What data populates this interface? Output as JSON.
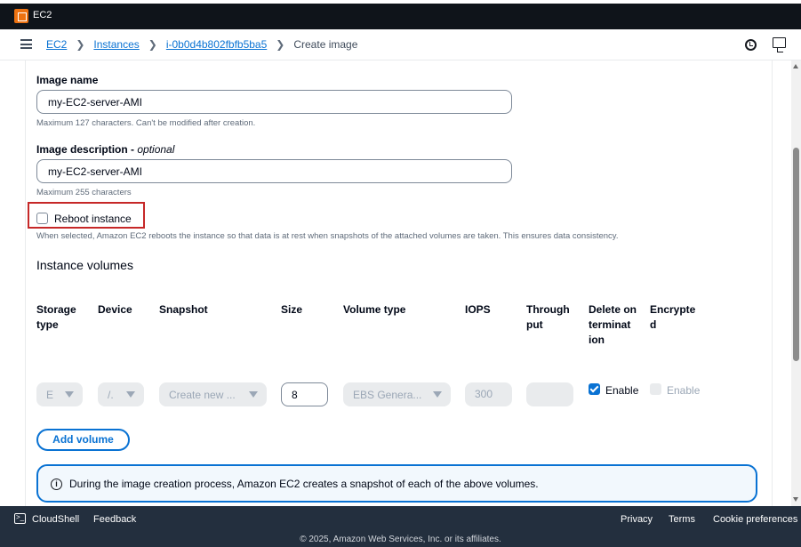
{
  "topbar": {
    "service": "EC2"
  },
  "breadcrumb": {
    "items": [
      "EC2",
      "Instances",
      "i-0b0d4b802fbfb5ba5"
    ],
    "current": "Create image"
  },
  "form": {
    "image_name": {
      "label": "Image name",
      "value": "my-EC2-server-AMI",
      "hint": "Maximum 127 characters. Can't be modified after creation."
    },
    "image_description": {
      "label": "Image description - ",
      "optional": "optional",
      "value": "my-EC2-server-AMI",
      "hint": "Maximum 255 characters"
    },
    "reboot": {
      "label": "Reboot instance",
      "checked": false,
      "hint": "When selected, Amazon EC2 reboots the instance so that data is at rest when snapshots of the attached volumes are taken. This ensures data consistency."
    }
  },
  "volumes": {
    "title": "Instance volumes",
    "headers": [
      "Storage type",
      "Device",
      "Snapshot",
      "Size",
      "Volume type",
      "IOPS",
      "Through put",
      "Delete on terminat ion",
      "Encrypte d"
    ],
    "row": {
      "storage_type": "E",
      "device": "/.",
      "snapshot": "Create new ...",
      "size": "8",
      "volume_type": "EBS Genera...",
      "iops": "300",
      "throughput": "",
      "delete_on_termination": {
        "checked": true,
        "label": "Enable"
      },
      "encrypted": {
        "checked": false,
        "label": "Enable"
      }
    },
    "add_button": "Add volume"
  },
  "alert": {
    "text": "During the image creation process, Amazon EC2 creates a snapshot of each of the above volumes."
  },
  "footer": {
    "cloudshell": "CloudShell",
    "feedback": "Feedback",
    "privacy": "Privacy",
    "terms": "Terms",
    "cookies": "Cookie preferences",
    "copyright": "© 2025, Amazon Web Services, Inc. or its affiliates."
  }
}
